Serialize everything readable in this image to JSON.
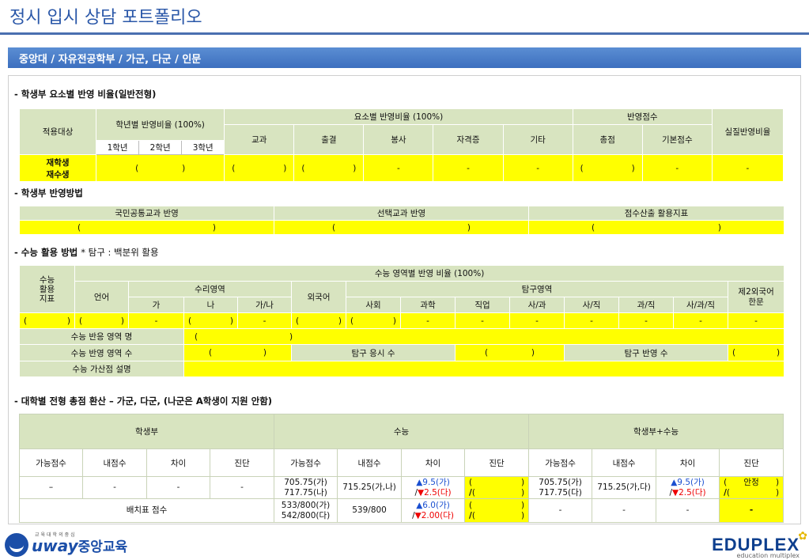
{
  "title": "정시 입시 상담 포트폴리오",
  "banner": "중앙대 / 자유전공학부 / 가군, 다군 / 인문",
  "s1": {
    "heading": "- 학생부 요소별 반영 비율(일반전형)",
    "h_target": "적용대상",
    "h_grade": "학년별 반영비율 (100%)",
    "g1": "1학년",
    "g2": "2학년",
    "g3": "3학년",
    "h_elem": "요소별 반영비율 (100%)",
    "h_subj": "교과",
    "h_attend": "출결",
    "h_vol": "봉사",
    "h_cert": "자격증",
    "h_etc": "기타",
    "h_score": "반영점수",
    "h_total": "총점",
    "h_base": "기본점수",
    "h_real": "실질반영비율",
    "r1": "재학생",
    "r2": "재수생",
    "lp": "(",
    "rp": ")",
    "dash": "-"
  },
  "s2": {
    "heading": "- 학생부 반영방법",
    "c1": "국민공통교과 반영",
    "c2": "선택교과 반영",
    "c3": "점수산출 활용지표"
  },
  "s3": {
    "heading": "- 수능 활용 방법",
    "note": "* 탐구 : 백분위 활용",
    "h_idx": "수능\n활용\n지표",
    "h_ratio": "수능 영역별 반영 비율 (100%)",
    "h_lang": "언어",
    "h_math": "수리영역",
    "m1": "가",
    "m2": "나",
    "m3": "가/나",
    "h_eng": "외국어",
    "h_inq": "탐구영역",
    "i1": "사회",
    "i2": "과학",
    "i3": "직업",
    "i4": "사/과",
    "i5": "사/직",
    "i6": "과/직",
    "i7": "사/과/직",
    "h_l2": "제2외국어\n한문",
    "row_name": "수능 반응 영역 명",
    "row_count": "수능 반영 영역 수",
    "inq_take": "탐구 응시 수",
    "inq_refl": "탐구 반영 수",
    "row_bonus": "수능 가산점 설명"
  },
  "s4": {
    "heading": "- 대학별 전형 총점 환산 – 가군, 다군, (나군은 A학생이 지원 안함)",
    "h_school": "학생부",
    "h_suneung": "수능",
    "h_both": "학생부+수능",
    "c_possible": "가능점수",
    "c_mine": "내점수",
    "c_diff": "차이",
    "c_diag": "진단",
    "r1_dash": "–",
    "dash": "-",
    "p1": "705.75(가)",
    "p2": "717.75(나)",
    "mine": "715.25(가,나)",
    "up": "▲9.5(가)",
    "slash": "/",
    "down": "▼2.5(다)",
    "p1b": "705.75(가)",
    "p2b": "717.75(다)",
    "mineb": "715.25(가,다)",
    "upb": "▲9.5(가)",
    "downb": "▼2.5(다)",
    "stable": "안정",
    "batch": "배치표 점수",
    "bp1": "533/800(가)",
    "bp2": "542/800(다)",
    "bmine": "539/800",
    "bup": "▲6.0(가)",
    "bdown": "▼2.00(다)"
  },
  "logos": {
    "uway": "uway",
    "uway_kr": "중앙교육",
    "uway_small": "교육대학의중심",
    "eduplex": "EDUPLEX",
    "eduplex_sub": "education multiplex"
  }
}
